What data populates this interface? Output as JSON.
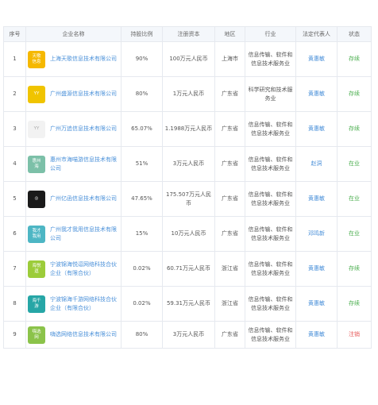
{
  "headers": {
    "idx": "序号",
    "company": "企业名称",
    "ratio": "持股比例",
    "capital": "注册资本",
    "region": "地区",
    "industry": "行业",
    "rep": "法定代表人",
    "status": "状态"
  },
  "rows": [
    {
      "idx": "1",
      "logo_text": "天歌\n信息",
      "logo_color": "#f5b800",
      "company": "上海天歌信息技术有限公司",
      "ratio": "90%",
      "capital": "100万元人民币",
      "region": "上海市",
      "industry": "信息传输、软件和信息技术服务业",
      "rep": "黄惠敏",
      "status": "存续",
      "status_color": "#4caf50"
    },
    {
      "idx": "2",
      "logo_text": "YY",
      "logo_color": "#f0c400",
      "company": "广州盛源信息技术有限公司",
      "ratio": "80%",
      "capital": "1万元人民币",
      "region": "广东省",
      "industry": "科学研究和技术服务业",
      "rep": "黄惠敏",
      "status": "存续",
      "status_color": "#4caf50"
    },
    {
      "idx": "3",
      "logo_text": "YY",
      "logo_color": "#f2f2f2",
      "company": "广州万追信息技术有限公司",
      "ratio": "65.07%",
      "capital": "1.1988万元人民币",
      "region": "广东省",
      "industry": "信息传输、软件和信息技术服务业",
      "rep": "黄惠敏",
      "status": "存续",
      "status_color": "#4caf50"
    },
    {
      "idx": "4",
      "logo_text": "惠州\n海",
      "logo_color": "#7cc0a8",
      "company": "惠州市海喵游信息技术有限公司",
      "ratio": "51%",
      "capital": "3万元人民币",
      "region": "广东省",
      "industry": "信息传输、软件和信息技术服务业",
      "rep": "赵洞",
      "status": "在业",
      "status_color": "#4caf50"
    },
    {
      "idx": "5",
      "logo_text": "◎",
      "logo_color": "#1a1a1a",
      "company": "广州亿函信息技术有限公司",
      "ratio": "47.65%",
      "capital": "175.507万元人民币",
      "region": "广东省",
      "industry": "信息传输、软件和信息技术服务业",
      "rep": "黄惠敏",
      "status": "在业",
      "status_color": "#4caf50"
    },
    {
      "idx": "6",
      "logo_text": "我才\n我用",
      "logo_color": "#4db6c4",
      "company": "广州我才我用信息技术有限公司",
      "ratio": "15%",
      "capital": "10万元人民币",
      "region": "广东省",
      "industry": "信息传输、软件和信息技术服务业",
      "rep": "邓鸣新",
      "status": "在业",
      "status_color": "#4caf50"
    },
    {
      "idx": "7",
      "logo_text": "海悦\n逗",
      "logo_color": "#9ccc3a",
      "company": "宁波锦海悦逗网络科技合伙企业（有限合伙）",
      "ratio": "0.02%",
      "capital": "60.71万元人民币",
      "region": "浙江省",
      "industry": "信息传输、软件和信息技术服务业",
      "rep": "黄惠敏",
      "status": "存续",
      "status_color": "#4caf50"
    },
    {
      "idx": "8",
      "logo_text": "海千\n游",
      "logo_color": "#26a6a6",
      "company": "宁波锦海千游网络科技合伙企业（有限合伙）",
      "ratio": "0.02%",
      "capital": "59.31万元人民币",
      "region": "浙江省",
      "industry": "信息传输、软件和信息技术服务业",
      "rep": "黄惠敏",
      "status": "存续",
      "status_color": "#4caf50"
    },
    {
      "idx": "9",
      "logo_text": "嗨选\n网",
      "logo_color": "#8bc34a",
      "company": "嗨选网络信息技术有限公司",
      "ratio": "80%",
      "capital": "3万元人民币",
      "region": "广东省",
      "industry": "信息传输、软件和信息技术服务业",
      "rep": "黄惠敏",
      "status": "注销",
      "status_color": "#e65555"
    }
  ]
}
